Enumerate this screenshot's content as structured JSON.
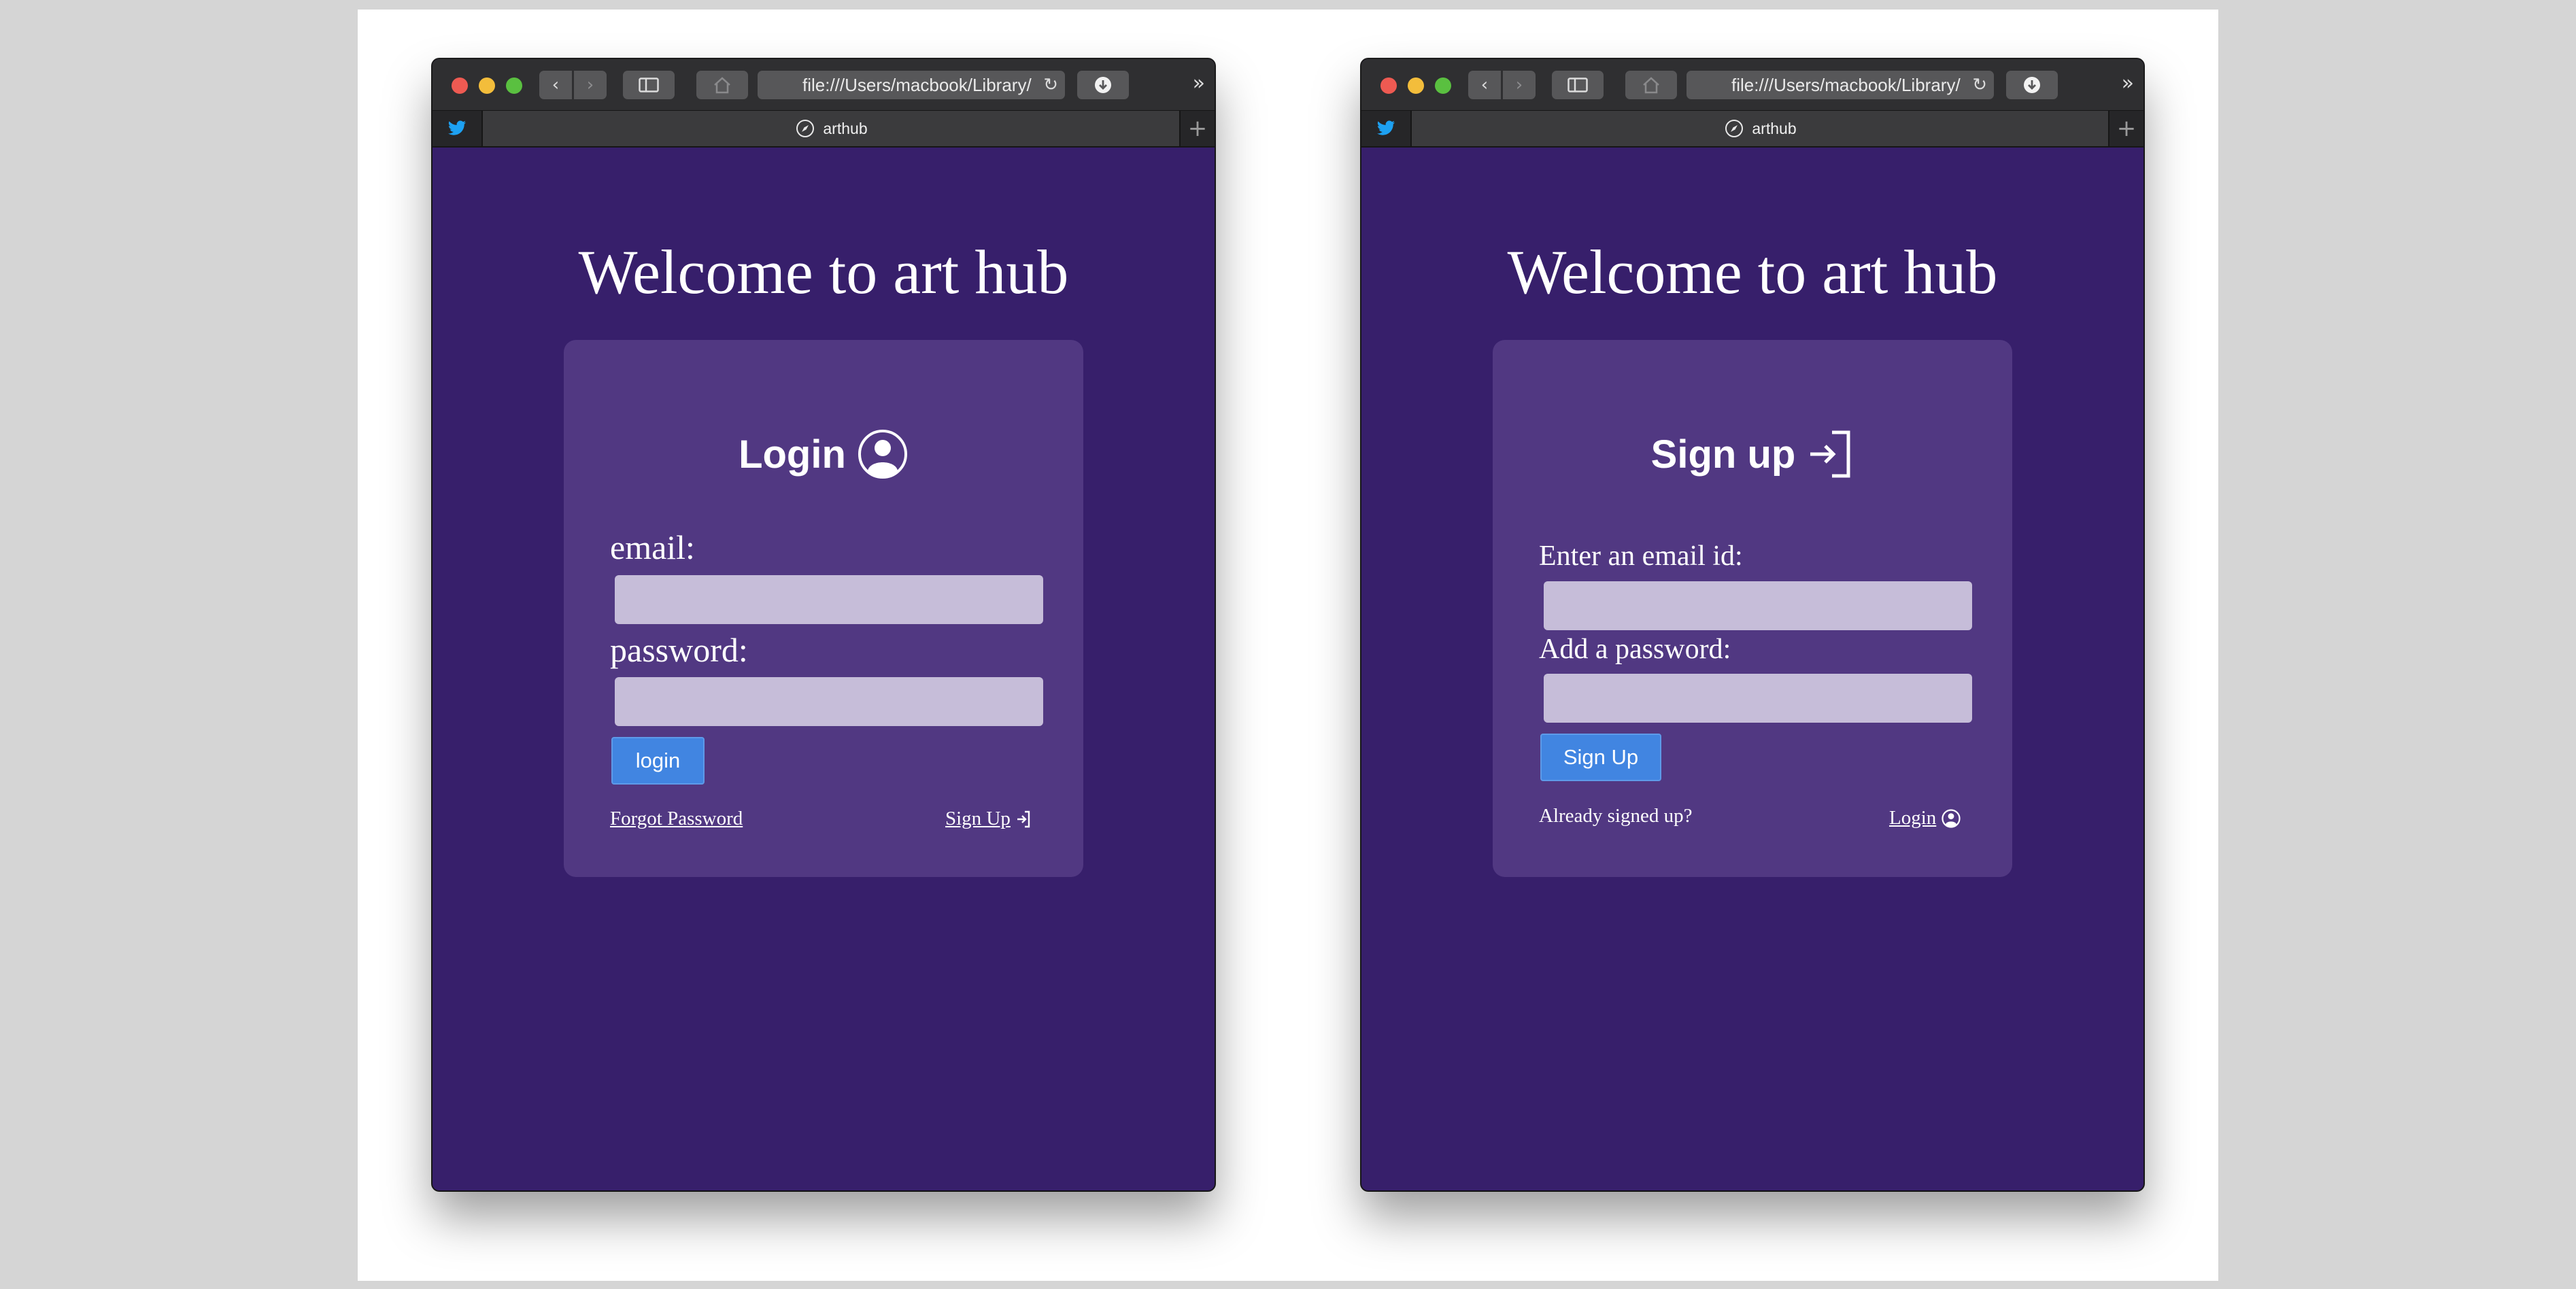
{
  "colors": {
    "page_background": "#371f6b",
    "card_background": "#513882",
    "input_background": "#c6bdd9",
    "button_blue": "#4185e1",
    "browser_chrome": "#2f2f31"
  },
  "login_window": {
    "browser": {
      "url": "file:///Users/macbook/Library/",
      "tab_title": "arthub",
      "pinned_tab_icon": "twitter-bird-icon"
    },
    "heading": "Welcome to art hub",
    "card": {
      "title": "Login",
      "title_icon": "user-circle-icon",
      "email_label": "email:",
      "password_label": "password:",
      "submit_label": "login",
      "forgot_link": "Forgot Password",
      "signup_link": "Sign Up",
      "signup_link_icon": "sign-in-arrow-icon"
    }
  },
  "signup_window": {
    "browser": {
      "url": "file:///Users/macbook/Library/",
      "tab_title": "arthub",
      "pinned_tab_icon": "twitter-bird-icon"
    },
    "heading": "Welcome to art hub",
    "card": {
      "title": "Sign up",
      "title_icon": "sign-in-arrow-icon",
      "email_label": "Enter an email id:",
      "password_label": "Add a password:",
      "submit_label": "Sign Up",
      "already_text": "Already signed up?",
      "login_link": "Login",
      "login_link_icon": "user-circle-icon"
    }
  }
}
